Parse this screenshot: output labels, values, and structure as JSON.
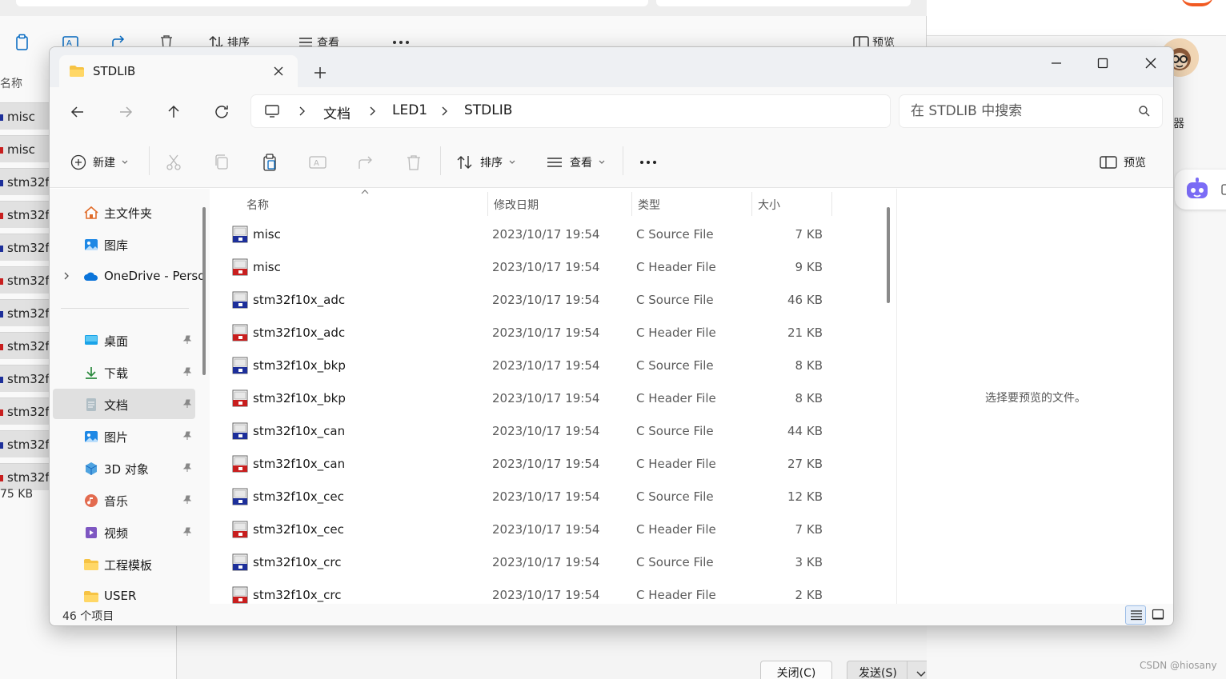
{
  "background": {
    "toolbar": {
      "sort_label": "排序",
      "view_label": "查看",
      "preview_label": "预览"
    },
    "list_header": "名称",
    "rows": [
      "misc",
      "misc",
      "stm32f",
      "stm32f",
      "stm32f",
      "stm32f",
      "stm32f",
      "stm32f",
      "stm32f",
      "stm32f",
      "stm32f",
      "stm32f"
    ],
    "size_text": "75 KB",
    "close_button": "关闭(C)",
    "send_button": "发送(S)",
    "side_text": "器",
    "watermark": "CSDN @hiosany"
  },
  "window": {
    "tab_title": "STDLIB",
    "breadcrumb": [
      "文档",
      "LED1",
      "STDLIB"
    ],
    "search_placeholder": "在 STDLIB 中搜索",
    "toolbar": {
      "new_label": "新建",
      "sort_label": "排序",
      "view_label": "查看",
      "preview_label": "预览"
    },
    "sidebar": {
      "top": [
        {
          "label": "主文件夹",
          "icon": "home-icon"
        },
        {
          "label": "图库",
          "icon": "gallery-icon"
        },
        {
          "label": "OneDrive - Perso",
          "icon": "onedrive-icon"
        }
      ],
      "pinned": [
        {
          "label": "桌面",
          "icon": "desktop-icon"
        },
        {
          "label": "下载",
          "icon": "download-icon"
        },
        {
          "label": "文档",
          "icon": "documents-icon"
        },
        {
          "label": "图片",
          "icon": "pictures-icon"
        },
        {
          "label": "3D 对象",
          "icon": "3d-objects-icon"
        },
        {
          "label": "音乐",
          "icon": "music-icon"
        },
        {
          "label": "视频",
          "icon": "videos-icon"
        },
        {
          "label": "工程模板",
          "icon": "folder-icon"
        },
        {
          "label": "USER",
          "icon": "folder-icon"
        }
      ]
    },
    "columns": {
      "name": "名称",
      "modified": "修改日期",
      "type": "类型",
      "size": "大小"
    },
    "files": [
      {
        "name": "misc",
        "modified": "2023/10/17 19:54",
        "type": "C Source File",
        "size": "7 KB",
        "kind": "c"
      },
      {
        "name": "misc",
        "modified": "2023/10/17 19:54",
        "type": "C Header File",
        "size": "9 KB",
        "kind": "h"
      },
      {
        "name": "stm32f10x_adc",
        "modified": "2023/10/17 19:54",
        "type": "C Source File",
        "size": "46 KB",
        "kind": "c"
      },
      {
        "name": "stm32f10x_adc",
        "modified": "2023/10/17 19:54",
        "type": "C Header File",
        "size": "21 KB",
        "kind": "h"
      },
      {
        "name": "stm32f10x_bkp",
        "modified": "2023/10/17 19:54",
        "type": "C Source File",
        "size": "8 KB",
        "kind": "c"
      },
      {
        "name": "stm32f10x_bkp",
        "modified": "2023/10/17 19:54",
        "type": "C Header File",
        "size": "8 KB",
        "kind": "h"
      },
      {
        "name": "stm32f10x_can",
        "modified": "2023/10/17 19:54",
        "type": "C Source File",
        "size": "44 KB",
        "kind": "c"
      },
      {
        "name": "stm32f10x_can",
        "modified": "2023/10/17 19:54",
        "type": "C Header File",
        "size": "27 KB",
        "kind": "h"
      },
      {
        "name": "stm32f10x_cec",
        "modified": "2023/10/17 19:54",
        "type": "C Source File",
        "size": "12 KB",
        "kind": "c"
      },
      {
        "name": "stm32f10x_cec",
        "modified": "2023/10/17 19:54",
        "type": "C Header File",
        "size": "7 KB",
        "kind": "h"
      },
      {
        "name": "stm32f10x_crc",
        "modified": "2023/10/17 19:54",
        "type": "C Source File",
        "size": "3 KB",
        "kind": "c"
      },
      {
        "name": "stm32f10x_crc",
        "modified": "2023/10/17 19:54",
        "type": "C Header File",
        "size": "2 KB",
        "kind": "h"
      }
    ],
    "preview_message": "选择要预览的文件。",
    "status_count": "46 个项目"
  },
  "colors": {
    "c_file": "#1d2f9a",
    "h_file": "#c81e1e",
    "folder": "#f6c344",
    "accent": "#0067c0"
  }
}
